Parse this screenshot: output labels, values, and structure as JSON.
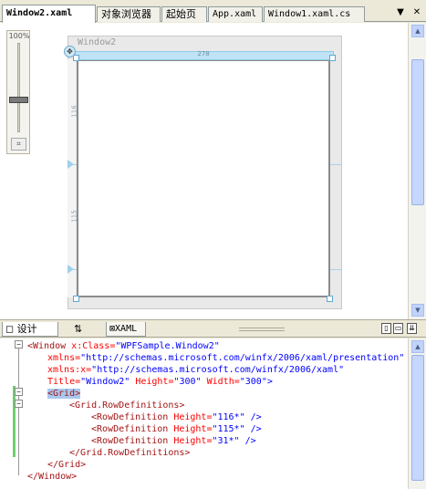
{
  "tabs": [
    {
      "label": "Window2.xaml",
      "active": true
    },
    {
      "label": "对象浏览器",
      "active": false
    },
    {
      "label": "起始页",
      "active": false
    },
    {
      "label": "App.xaml",
      "active": false
    },
    {
      "label": "Window1.xaml.cs",
      "active": false
    }
  ],
  "tab_controls": {
    "dropdown": "▼",
    "close": "✕"
  },
  "zoom": {
    "percent_label": "100%",
    "level": 0.6
  },
  "designer": {
    "window_title": "Window2",
    "grid_width_label": "278",
    "row_labels": [
      "116",
      "115"
    ]
  },
  "bottom_bar": {
    "design_tab": "设计",
    "swap_symbol": "⇅",
    "xaml_tab": "XAML"
  },
  "code_lines": [
    {
      "tag": "<Window",
      "attr": " x:Class=",
      "val": "\"WPFSample.Window2\""
    },
    {
      "attr": "xmlns=",
      "val": "\"http://schemas.microsoft.com/winfx/2006/xaml/presentation\""
    },
    {
      "attr": "xmlns:x=",
      "val": "\"http://schemas.microsoft.com/winfx/2006/xaml\""
    },
    {
      "attr": "Title=",
      "val": "\"Window2\"",
      "attr2": " Height=",
      "val2": "\"300\"",
      "attr3": " Width=",
      "val3": "\"300\"",
      "tail": ">"
    },
    {
      "tag": "<Grid>"
    },
    {
      "tag": "<Grid.RowDefinitions>"
    },
    {
      "tag": "<RowDefinition",
      "attr": " Height=",
      "val": "\"116*\"",
      "tail": " />"
    },
    {
      "tag": "<RowDefinition",
      "attr": " Height=",
      "val": "\"115*\"",
      "tail": " />"
    },
    {
      "tag": "<RowDefinition",
      "attr": " Height=",
      "val": "\"31*\"",
      "tail": " />"
    },
    {
      "tag": "</Grid.RowDefinitions>"
    },
    {
      "tag": "</Grid>"
    },
    {
      "tag": "</Window>"
    }
  ],
  "colors": {
    "tag": "#a31515",
    "attr": "#ff0000",
    "value": "#0000ff",
    "selection": "#a8c8f0"
  }
}
